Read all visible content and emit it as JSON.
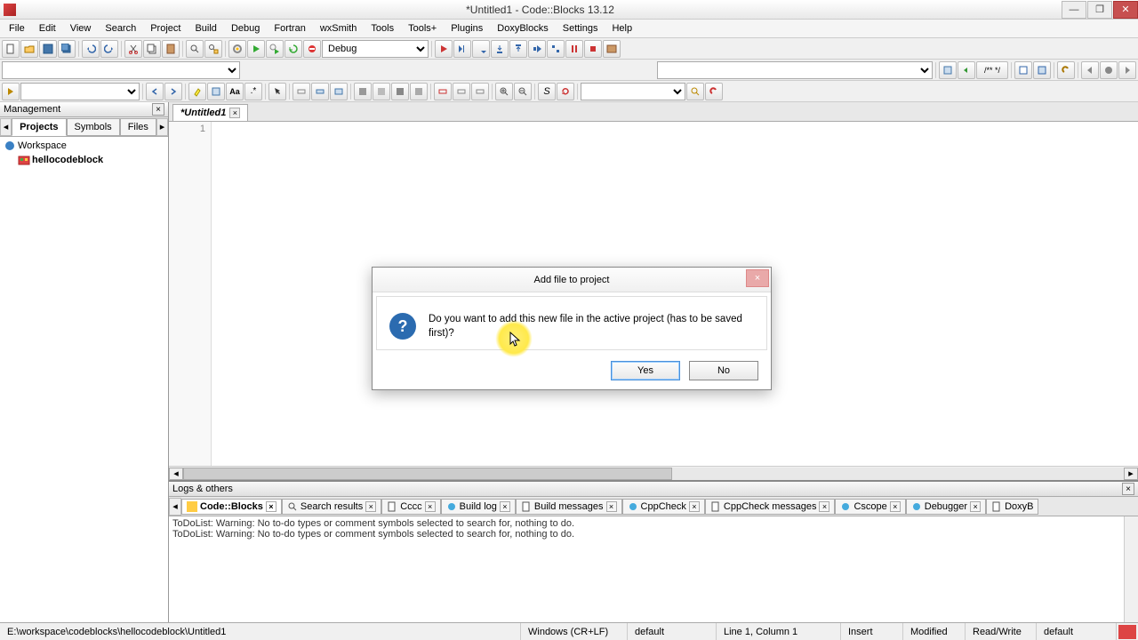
{
  "window": {
    "title": "*Untitled1 - Code::Blocks 13.12"
  },
  "menu": [
    "File",
    "Edit",
    "View",
    "Search",
    "Project",
    "Build",
    "Debug",
    "Fortran",
    "wxSmith",
    "Tools",
    "Tools+",
    "Plugins",
    "DoxyBlocks",
    "Settings",
    "Help"
  ],
  "toolbar": {
    "build_target": "Debug"
  },
  "management": {
    "title": "Management",
    "tabs": {
      "projects": "Projects",
      "symbols": "Symbols",
      "files": "Files"
    },
    "workspace": "Workspace",
    "project": "hellocodeblock"
  },
  "editor": {
    "tab": "*Untitled1",
    "line_number": "1"
  },
  "logs": {
    "title": "Logs & others",
    "tabs": [
      "Code::Blocks",
      "Search results",
      "Cccc",
      "Build log",
      "Build messages",
      "CppCheck",
      "CppCheck messages",
      "Cscope",
      "Debugger",
      "DoxyB"
    ],
    "line1": "ToDoList: Warning: No to-do types or comment symbols selected to search for, nothing to do.",
    "line2": "ToDoList: Warning: No to-do types or comment symbols selected to search for, nothing to do."
  },
  "dialog": {
    "title": "Add file to project",
    "message": "Do you want to add this new file in the active project (has to be saved first)?",
    "yes": "Yes",
    "no": "No"
  },
  "status": {
    "path": "E:\\workspace\\codeblocks\\hellocodeblock\\Untitled1",
    "eol": "Windows (CR+LF)",
    "enc": "default",
    "pos": "Line 1, Column 1",
    "ins": "Insert",
    "mod": "Modified",
    "rw": "Read/Write",
    "lang": "default"
  }
}
